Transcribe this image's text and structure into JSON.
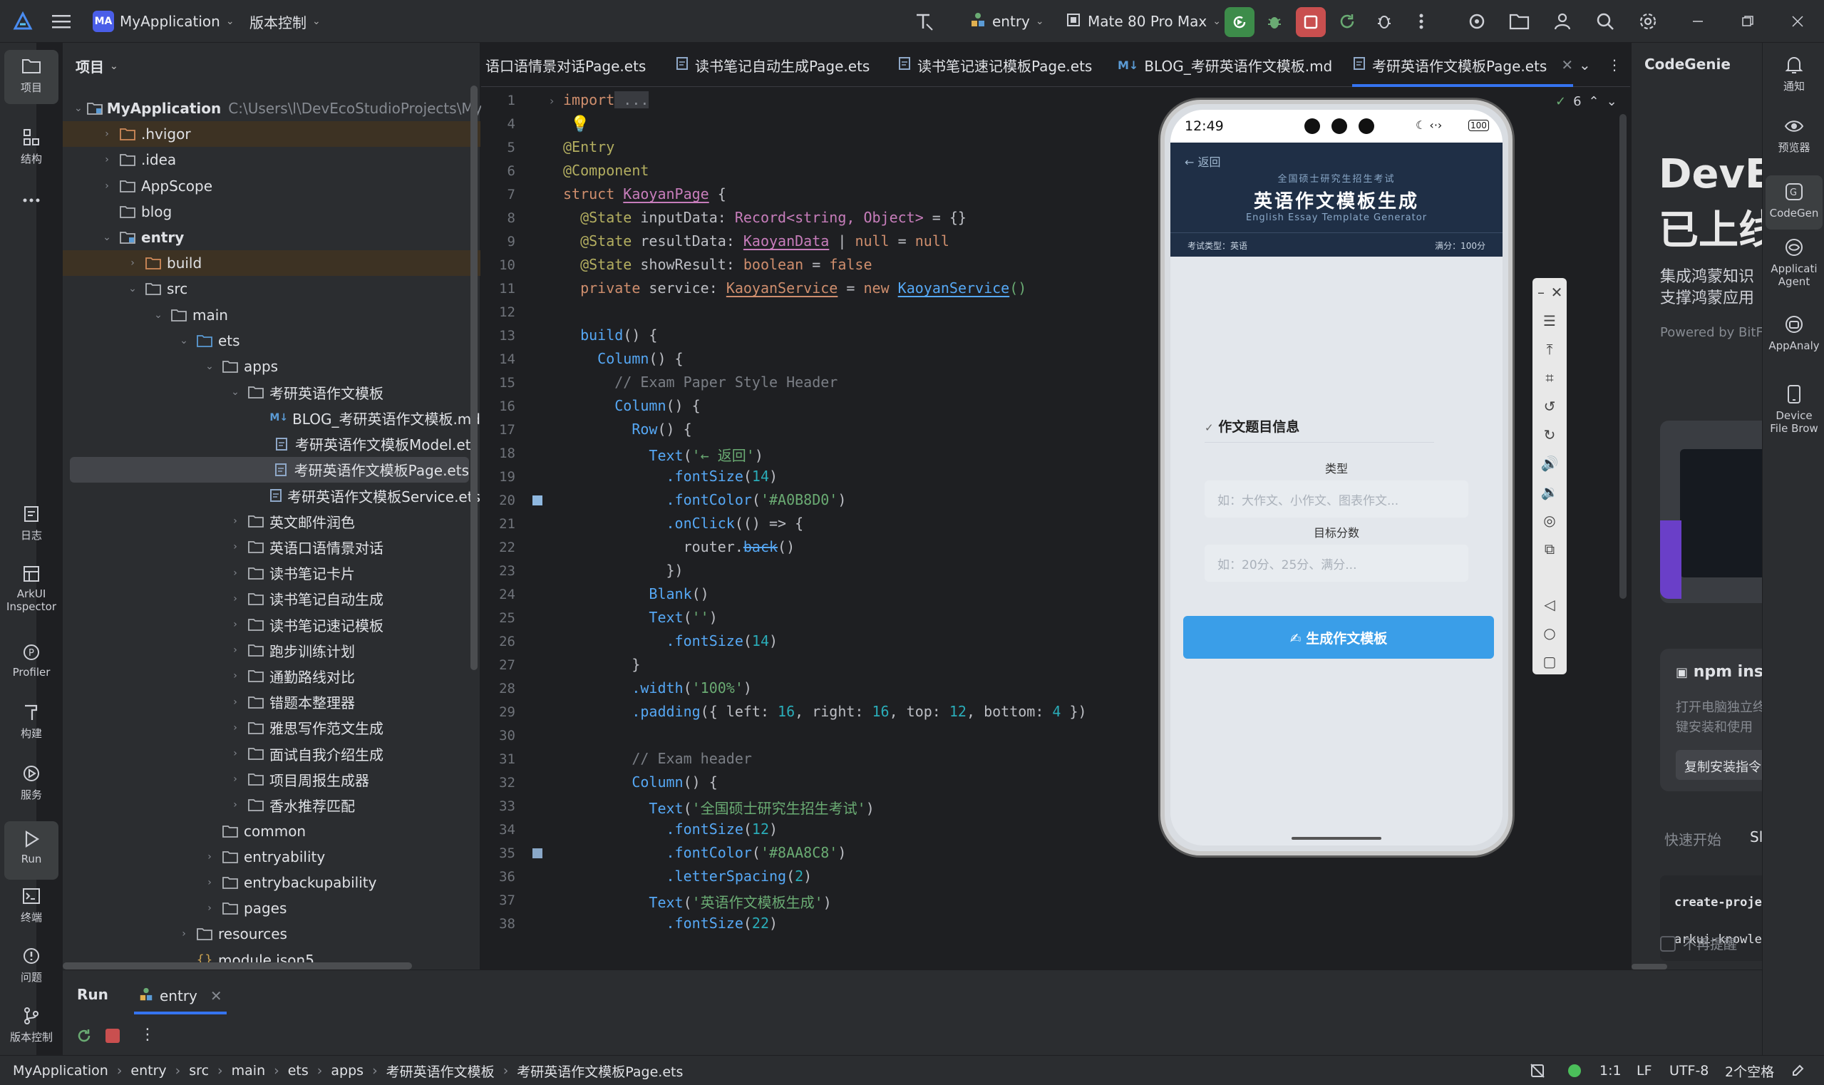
{
  "titlebar": {
    "project_badge": "MA",
    "project_name": "MyApplication",
    "vcs_label": "版本控制",
    "run_config": "entry",
    "device": "Mate 80 Pro Max"
  },
  "left_strip": {
    "project": "项目",
    "structure": "结构",
    "log": "日志",
    "arkui1": "ArkUI",
    "arkui2": "Inspector",
    "profiler": "Profiler",
    "build": "构建",
    "services": "服务",
    "run": "Run",
    "terminal": "终端",
    "problems": "问题",
    "vcs": "版本控制"
  },
  "project_panel": {
    "title": "项目",
    "tree": [
      {
        "label": "MyApplication",
        "extra": "C:\\Users\\l\\DevEcoStudioProjects\\MyApplic",
        "bold": true
      },
      {
        "label": ".hvigor"
      },
      {
        "label": ".idea"
      },
      {
        "label": "AppScope"
      },
      {
        "label": "blog"
      },
      {
        "label": "entry",
        "bold": true
      },
      {
        "label": "build"
      },
      {
        "label": "src"
      },
      {
        "label": "main"
      },
      {
        "label": "ets"
      },
      {
        "label": "apps"
      },
      {
        "label": "考研英语作文模板"
      },
      {
        "label": "BLOG_考研英语作文模板.md"
      },
      {
        "label": "考研英语作文模板Model.ets"
      },
      {
        "label": "考研英语作文模板Page.ets"
      },
      {
        "label": "考研英语作文模板Service.ets"
      },
      {
        "label": "英文邮件润色"
      },
      {
        "label": "英语口语情景对话"
      },
      {
        "label": "读书笔记卡片"
      },
      {
        "label": "读书笔记自动生成"
      },
      {
        "label": "读书笔记速记模板"
      },
      {
        "label": "跑步训练计划"
      },
      {
        "label": "通勤路线对比"
      },
      {
        "label": "错题本整理器"
      },
      {
        "label": "雅思写作范文生成"
      },
      {
        "label": "面试自我介绍生成"
      },
      {
        "label": "项目周报生成器"
      },
      {
        "label": "香水推荐匹配"
      },
      {
        "label": "common"
      },
      {
        "label": "entryability"
      },
      {
        "label": "entrybackupability"
      },
      {
        "label": "pages"
      },
      {
        "label": "resources"
      },
      {
        "label": "module.json5"
      }
    ]
  },
  "tabs": [
    {
      "label": "语口语情景对话Page.ets"
    },
    {
      "label": "读书笔记自动生成Page.ets"
    },
    {
      "label": "读书笔记速记模板Page.ets"
    },
    {
      "label": "BLOG_考研英语作文模板.md"
    },
    {
      "label": "考研英语作文模板Page.ets",
      "active": true
    }
  ],
  "editor": {
    "warnings": "6",
    "line_numbers": [
      "1",
      "4",
      "5",
      "6",
      "7",
      "8",
      "9",
      "10",
      "11",
      "12",
      "13",
      "14",
      "15",
      "16",
      "17",
      "18",
      "19",
      "20",
      "21",
      "22",
      "23",
      "24",
      "25",
      "26",
      "27",
      "28",
      "29",
      "30",
      "31",
      "32",
      "33",
      "34",
      "35",
      "36",
      "37",
      "38"
    ],
    "code": {
      "l1_kw": "import",
      "l1_rest": " ...",
      "l5": "@Entry",
      "l6": "@Component",
      "l7_kw": "struct",
      "l7_name": "KaoyanPage",
      "l7_brace": " {",
      "l8_ann": "@State",
      "l8_rest": " inputData: ",
      "l8_type": "Record<string, Object>",
      "l8_end": " = {}",
      "l9_ann": "@State",
      "l9_rest": " resultData: ",
      "l9_type": "KaoyanData",
      "l9_mid": " | ",
      "l9_null": "null",
      "l9_eq": " = ",
      "l9_null2": "null",
      "l10_ann": "@State",
      "l10_rest": " showResult: ",
      "l10_type": "boolean",
      "l10_eq": " = ",
      "l10_val": "false",
      "l11_kw": "private",
      "l11_rest": " service: ",
      "l11_type": "KaoyanService",
      "l11_eq": " = ",
      "l11_new": "new",
      "l11_cls": "KaoyanService",
      "l11_end": "()",
      "l13_fn": "build",
      "l13_rest": "() {",
      "l14_fn": "Column",
      "l14_rest": "() {",
      "l15": "// Exam Paper Style Header",
      "l16_fn": "Column",
      "l16_rest": "() {",
      "l17_fn": "Row",
      "l17_rest": "() {",
      "l18_fn": "Text",
      "l18_str": "'← 返回'",
      "l19_fn": ".fontSize",
      "l19_num": "14",
      "l20_fn": ".fontColor",
      "l20_str": "'#A0B8D0'",
      "l21_fn": ".onClick",
      "l21_rest": "(() => {",
      "l22_obj": "router.",
      "l22_fn": "back",
      "l22_end": "()",
      "l23": "})",
      "l24_fn": "Blank",
      "l24_rest": "()",
      "l25_fn": "Text",
      "l25_str": "''",
      "l26_fn": ".fontSize",
      "l26_num": "14",
      "l27": "}",
      "l28_fn": ".width",
      "l28_str": "'100%'",
      "l29_fn": ".padding",
      "l29_a": "({ left: ",
      "l29_n1": "16",
      "l29_b": ", right: ",
      "l29_n2": "16",
      "l29_c": ", top: ",
      "l29_n3": "12",
      "l29_d": ", bottom: ",
      "l29_n4": "4",
      "l29_e": " })",
      "l31": "// Exam header",
      "l32_fn": "Column",
      "l32_rest": "() {",
      "l33_fn": "Text",
      "l33_str": "'全国硕士研究生招生考试'",
      "l34_fn": ".fontSize",
      "l34_num": "12",
      "l35_fn": ".fontColor",
      "l35_str": "'#8AA8C8'",
      "l36_fn": ".letterSpacing",
      "l36_num": "2",
      "l37_fn": "Text",
      "l37_str": "'英语作文模板生成'",
      "l38_fn": ".fontSize",
      "l38_num": "22"
    }
  },
  "phone": {
    "time": "12:49",
    "battery": "100",
    "back": "← 返回",
    "exam_title": "全国硕士研究生招生考试",
    "title": "英语作文模板生成",
    "subtitle": "English Essay Template Generator",
    "exam_type": "考试类型：英语",
    "full_score": "满分：100分",
    "card_title": "作文题目信息",
    "label_type": "类型",
    "placeholder_type": "如：大作文、小作文、图表作文...",
    "label_score": "目标分数",
    "placeholder_score": "如：20分、25分、满分...",
    "generate_btn": "✍ 生成作文模板"
  },
  "codegenie": {
    "title": "CodeGenie",
    "headline1": "DevEc",
    "headline2": "已上线",
    "desc1": "集成鸿蒙知识",
    "desc2": "支撑鸿蒙应用",
    "powered": "Powered by BitFu",
    "npm_title": "npm ins",
    "npm_desc1": "打开电脑独立终",
    "npm_desc2": "键安装和使用",
    "npm_btn": "复制安装指令",
    "tab1": "快速开始",
    "tab2": "Sl",
    "cmd1": "create-proje",
    "cmd2": "arkui-knowled",
    "dont_remind": "不再提醒"
  },
  "right_strip": {
    "notifications": "通知",
    "previewer": "预览器",
    "codegenie1": "CodeGen",
    "agent1": "Applicati",
    "agent2": "Agent",
    "appanalyzer": "AppAnaly",
    "dfb1": "Device",
    "dfb2": "File Brow"
  },
  "run_panel": {
    "run_tab": "Run",
    "entry_tab": "entry"
  },
  "statusbar": {
    "crumbs": [
      "MyApplication",
      "entry",
      "src",
      "main",
      "ets",
      "apps",
      "考研英语作文模板",
      "考研英语作文模板Page.ets"
    ],
    "position": "1:1",
    "line_sep": "LF",
    "encoding": "UTF-8",
    "indent": "2个空格"
  }
}
